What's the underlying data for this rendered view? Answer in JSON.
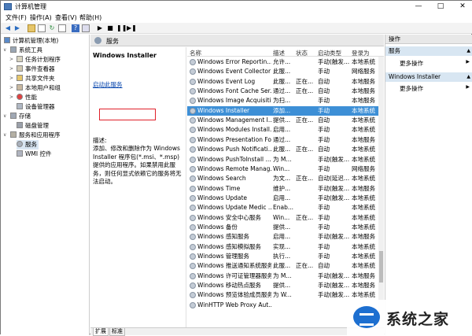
{
  "window": {
    "title": "计算机管理",
    "min": "—",
    "max": "□",
    "close": "✕"
  },
  "menu": [
    "文件(F)",
    "操作(A)",
    "查看(V)",
    "帮助(H)"
  ],
  "toolbar_icons": [
    "back-icon",
    "forward-icon",
    "folder-up-icon",
    "properties-icon",
    "refresh-icon",
    "export-icon",
    "help-icon",
    "console-icon",
    "play-icon",
    "stop-icon",
    "pause-icon",
    "restart-icon"
  ],
  "tree": [
    {
      "label": "计算机管理(本地)",
      "level": 0,
      "icon": "computer-icon"
    },
    {
      "label": "系统工具",
      "level": 1,
      "expander": "∨",
      "icon": "tools-icon"
    },
    {
      "label": "任务计划程序",
      "level": 2,
      "expander": ">",
      "icon": "clock-icon"
    },
    {
      "label": "事件查看器",
      "level": 2,
      "expander": ">",
      "icon": "event-icon"
    },
    {
      "label": "共享文件夹",
      "level": 2,
      "expander": ">",
      "icon": "folder-icon"
    },
    {
      "label": "本地用户和组",
      "level": 2,
      "expander": ">",
      "icon": "users-icon"
    },
    {
      "label": "性能",
      "level": 2,
      "expander": ">",
      "icon": "performance-icon"
    },
    {
      "label": "设备管理器",
      "level": 2,
      "expander": "",
      "icon": "device-icon"
    },
    {
      "label": "存储",
      "level": 1,
      "expander": "∨",
      "icon": "storage-icon"
    },
    {
      "label": "磁盘管理",
      "level": 2,
      "expander": "",
      "icon": "disk-icon"
    },
    {
      "label": "服务和应用程序",
      "level": 1,
      "expander": "∨",
      "icon": "services-apps-icon"
    },
    {
      "label": "服务",
      "level": 2,
      "expander": "",
      "icon": "gear-icon",
      "selected": true
    },
    {
      "label": "WMI 控件",
      "level": 2,
      "expander": "",
      "icon": "wmi-icon"
    }
  ],
  "center": {
    "header": "服务",
    "service_title": "Windows Installer",
    "start_link": "启动此服务",
    "desc_label": "描述:",
    "desc_text": "添加、修改和删除作为 Windows Installer 程序包(*.msi、*.msp)提供的应用程序。如果禁用此服务，则任何显式依赖它的服务将无法启动。"
  },
  "columns": [
    "名称",
    "描述",
    "状态",
    "启动类型",
    "登录为"
  ],
  "services": [
    {
      "name": "Windows Error Reportin...",
      "desc": "允许...",
      "status": "",
      "startup": "手动(触发...",
      "logon": "本地系统"
    },
    {
      "name": "Windows Event Collector",
      "desc": "此服...",
      "status": "",
      "startup": "手动",
      "logon": "网络服务"
    },
    {
      "name": "Windows Event Log",
      "desc": "此服...",
      "status": "正在...",
      "startup": "自动",
      "logon": "本地服务"
    },
    {
      "name": "Windows Font Cache Ser...",
      "desc": "通过...",
      "status": "正在...",
      "startup": "自动",
      "logon": "本地服务"
    },
    {
      "name": "Windows Image Acquisiti...",
      "desc": "为扫...",
      "status": "",
      "startup": "手动",
      "logon": "本地服务"
    },
    {
      "name": "Windows Installer",
      "desc": "添加...",
      "status": "",
      "startup": "手动",
      "logon": "本地系统",
      "selected": true
    },
    {
      "name": "Windows Management I...",
      "desc": "提供...",
      "status": "正在...",
      "startup": "自动",
      "logon": "本地系统"
    },
    {
      "name": "Windows Modules Install...",
      "desc": "启用...",
      "status": "",
      "startup": "手动",
      "logon": "本地系统"
    },
    {
      "name": "Windows Presentation Fo...",
      "desc": "通过...",
      "status": "",
      "startup": "手动",
      "logon": "本地服务"
    },
    {
      "name": "Windows Push Notificati...",
      "desc": "此服...",
      "status": "正在...",
      "startup": "自动",
      "logon": "本地系统"
    },
    {
      "name": "Windows PushToInstall ...",
      "desc": "为 M...",
      "status": "",
      "startup": "手动(触发...",
      "logon": "本地系统"
    },
    {
      "name": "Windows Remote Manag...",
      "desc": "Win...",
      "status": "",
      "startup": "手动",
      "logon": "网络服务"
    },
    {
      "name": "Windows Search",
      "desc": "为文...",
      "status": "正在...",
      "startup": "自动(延迟...",
      "logon": "本地系统"
    },
    {
      "name": "Windows Time",
      "desc": "维护...",
      "status": "",
      "startup": "手动(触发...",
      "logon": "本地服务"
    },
    {
      "name": "Windows Update",
      "desc": "启用...",
      "status": "",
      "startup": "手动(触发...",
      "logon": "本地系统"
    },
    {
      "name": "Windows Update Medic ...",
      "desc": "Enab...",
      "status": "",
      "startup": "手动",
      "logon": "本地系统"
    },
    {
      "name": "Windows 安全中心服务",
      "desc": "Win...",
      "status": "正在...",
      "startup": "手动",
      "logon": "本地系统"
    },
    {
      "name": "Windows 备份",
      "desc": "提供...",
      "status": "",
      "startup": "手动",
      "logon": "本地系统"
    },
    {
      "name": "Windows 感知服务",
      "desc": "启用...",
      "status": "",
      "startup": "手动(触发...",
      "logon": "本地服务"
    },
    {
      "name": "Windows 感知模拟服务",
      "desc": "实现...",
      "status": "",
      "startup": "手动",
      "logon": "本地系统"
    },
    {
      "name": "Windows 管理服务",
      "desc": "执行...",
      "status": "",
      "startup": "手动",
      "logon": "本地系统"
    },
    {
      "name": "Windows 推送通知系统服务",
      "desc": "此服...",
      "status": "正在...",
      "startup": "自动",
      "logon": "本地系统"
    },
    {
      "name": "Windows 许可证管理器服务",
      "desc": "为 M...",
      "status": "",
      "startup": "手动(触发...",
      "logon": "本地服务"
    },
    {
      "name": "Windows 移动热点服务",
      "desc": "提供...",
      "status": "",
      "startup": "手动(触发...",
      "logon": "本地服务"
    },
    {
      "name": "Windows 预览体验成员服务",
      "desc": "为 W...",
      "status": "",
      "startup": "手动(触发...",
      "logon": "本地系统"
    },
    {
      "name": "WinHTTP Web Proxy Aut...",
      "desc": "",
      "status": "",
      "startup": "",
      "logon": ""
    }
  ],
  "actions": {
    "header": "操作",
    "sections": [
      {
        "title": "服务",
        "items": [
          "更多操作"
        ]
      },
      {
        "title": "Windows Installer",
        "items": [
          "更多操作"
        ]
      }
    ]
  },
  "tabs": [
    "扩展",
    "标准"
  ],
  "watermark": {
    "text": "系统之家"
  }
}
